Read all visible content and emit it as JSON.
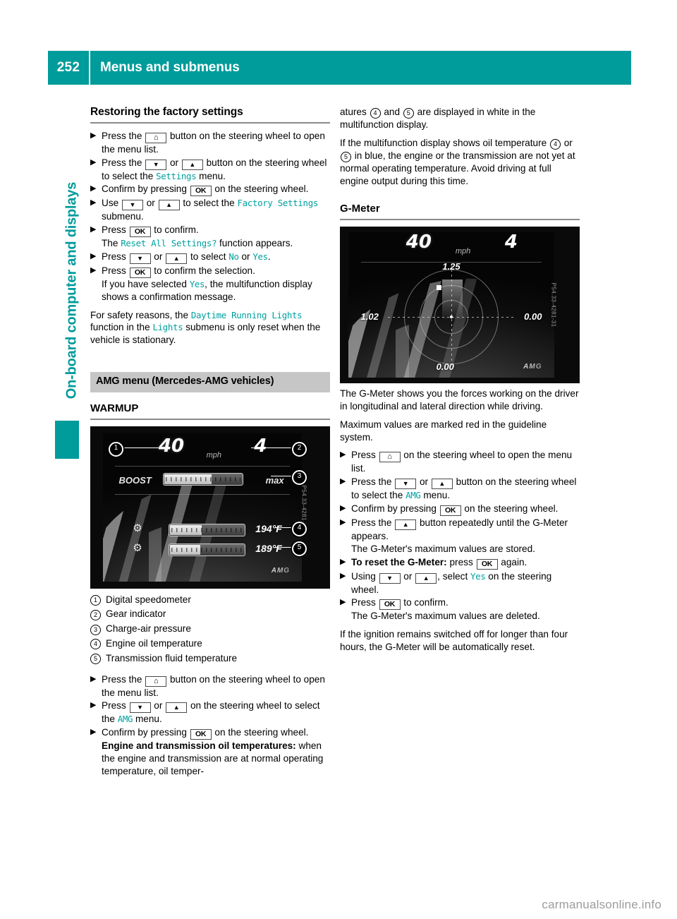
{
  "header": {
    "page_number": "252",
    "title": "Menus and submenus"
  },
  "side_tab": {
    "label": "On-board computer and displays"
  },
  "left_column": {
    "section_title": "Restoring the factory settings",
    "steps": [
      {
        "parts": [
          "Press the",
          "KEY_HOME",
          "button on the steering wheel to open the menu list."
        ]
      },
      {
        "parts": [
          "Press the",
          "KEY_DOWN",
          "or",
          "KEY_UP",
          "button on the steering wheel to select the",
          "UI:Settings",
          "menu."
        ]
      },
      {
        "parts": [
          "Confirm by pressing",
          "KEY_OK",
          "on the steering wheel."
        ]
      },
      {
        "parts": [
          "Use",
          "KEY_DOWN",
          "or",
          "KEY_UP",
          "to select the",
          "UI:Factory Settings",
          "submenu."
        ]
      },
      {
        "parts": [
          "Press",
          "KEY_OK",
          "to confirm."
        ],
        "continuation": [
          "The",
          "UI:Reset All Settings?",
          "function appears."
        ]
      },
      {
        "parts": [
          "Press",
          "KEY_DOWN",
          "or",
          "KEY_UP",
          "to select",
          "UI:No",
          "or",
          "UI:Yes",
          "."
        ]
      },
      {
        "parts": [
          "Press",
          "KEY_OK",
          "to confirm the selection."
        ],
        "continuation": [
          "If you have selected",
          "UI:Yes",
          ", the multifunction display shows a confirmation message."
        ]
      }
    ],
    "safety_note_part1": "For safety reasons, the",
    "safety_note_ui1": "Daytime Running Lights",
    "safety_note_part2": "function in the",
    "safety_note_ui2": "Lights",
    "safety_note_part3": "submenu is only reset when the vehicle is stationary.",
    "amg_band": "AMG menu (Mercedes-AMG vehicles)",
    "warmup_title": "WARMUP",
    "warmup_figure": {
      "speed": "40",
      "speed_unit": "mph",
      "gear": "4",
      "boost_label": "BOOST",
      "max_label": "max",
      "oil_temp": "194°F",
      "trans_temp": "189°F",
      "brand": "AMG",
      "photo_code": "P54.33-4281-31",
      "callouts": [
        "1",
        "2",
        "3",
        "4",
        "5"
      ]
    },
    "legend": [
      {
        "num": "1",
        "text": "Digital speedometer"
      },
      {
        "num": "2",
        "text": "Gear indicator"
      },
      {
        "num": "3",
        "text": "Charge-air pressure"
      },
      {
        "num": "4",
        "text": "Engine oil temperature"
      },
      {
        "num": "5",
        "text": "Transmission fluid temperature"
      }
    ],
    "steps2": [
      {
        "parts": [
          "Press the",
          "KEY_HOME",
          "button on the steering wheel to open the menu list."
        ]
      },
      {
        "parts": [
          "Press",
          "KEY_DOWN",
          "or",
          "KEY_UP",
          "on the steering wheel to select the",
          "UI:AMG",
          "menu."
        ]
      },
      {
        "parts": [
          "Confirm by pressing",
          "KEY_OK",
          "on the steering wheel."
        ],
        "continuation_bold": "Engine and transmission oil temperatures:",
        "continuation_rest": "when the engine and transmission are at normal operating temperature, oil temper-"
      }
    ]
  },
  "right_column": {
    "continued_part1": "atures",
    "continued_num1": "4",
    "continued_part2": "and",
    "continued_num2": "5",
    "continued_part3": "are displayed in white in the multifunction display.",
    "para2_part1": "If the multifunction display shows oil temperature",
    "para2_num1": "4",
    "para2_part2": "or",
    "para2_num2": "5",
    "para2_part3": "in blue, the engine or the transmission are not yet at normal operating temperature. Avoid driving at full engine output during this time.",
    "gmeter_title": "G-Meter",
    "gmeter_figure": {
      "speed": "40",
      "speed_unit": "mph",
      "gear": "4",
      "value_top": "1.25",
      "value_left": "1.02",
      "value_right": "0.00",
      "value_bottom": "0.00",
      "brand": "AMG",
      "photo_code": "P54.33-4281-31"
    },
    "para3": "The G-Meter shows you the forces working on the driver in longitudinal and lateral direction while driving.",
    "para4": "Maximum values are marked red in the guideline system.",
    "steps": [
      {
        "parts": [
          "Press",
          "KEY_HOME",
          "on the steering wheel to open the menu list."
        ]
      },
      {
        "parts": [
          "Press the",
          "KEY_DOWN",
          "or",
          "KEY_UP",
          "button on the steering wheel to select the",
          "UI:AMG",
          "menu."
        ]
      },
      {
        "parts": [
          "Confirm by pressing",
          "KEY_OK",
          "on the steering wheel."
        ]
      },
      {
        "parts": [
          "Press the",
          "KEY_UP",
          "button repeatedly until the G-Meter appears."
        ],
        "continuation": [
          "The G-Meter's maximum values are stored."
        ]
      },
      {
        "bold_lead": "To reset the G-Meter:",
        "parts": [
          "press",
          "KEY_OK",
          "again."
        ]
      },
      {
        "parts": [
          "Using",
          "KEY_DOWN",
          "or",
          "KEY_UP",
          ", select",
          "UI:Yes",
          "on the steering wheel."
        ]
      },
      {
        "parts": [
          "Press",
          "KEY_OK",
          "to confirm."
        ],
        "continuation": [
          "The G-Meter's maximum values are deleted."
        ]
      }
    ],
    "para5": "If the ignition remains switched off for longer than four hours, the G-Meter will be automatically reset."
  },
  "watermark": "carmanualsonline.info",
  "colors": {
    "accent_teal": "#009b9b",
    "ui_term_teal": "#00a0a0",
    "band_gray": "#c6c6c6"
  },
  "keys": {
    "home": "⌂",
    "down": "▼",
    "up": "▲",
    "ok": "OK"
  }
}
